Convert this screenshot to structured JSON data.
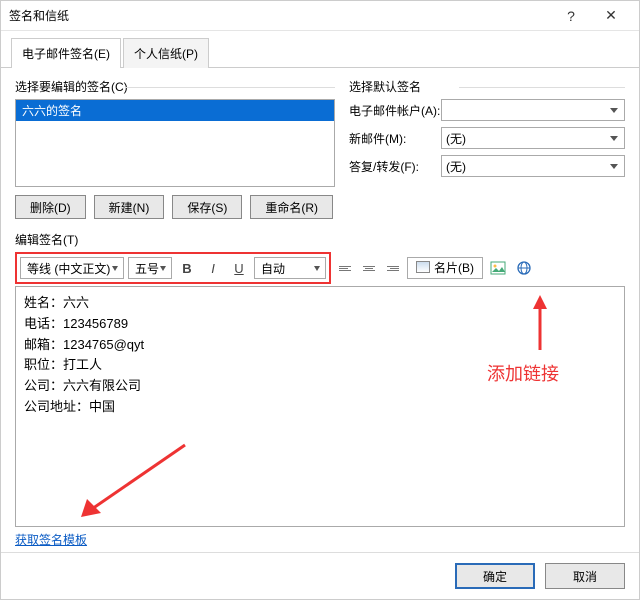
{
  "titlebar": {
    "title": "签名和信纸"
  },
  "tabs": {
    "t1": "电子邮件签名(E)",
    "t2": "个人信纸(P)"
  },
  "left": {
    "label": "选择要编辑的签名(C)",
    "item": "六六的签名",
    "btn_delete": "删除(D)",
    "btn_new": "新建(N)",
    "btn_save": "保存(S)",
    "btn_rename": "重命名(R)"
  },
  "right": {
    "label": "选择默认签名",
    "f1": "电子邮件帐户(A):",
    "v1": "",
    "f2": "新邮件(M):",
    "v2": "(无)",
    "f3": "答复/转发(F):",
    "v3": "(无)"
  },
  "edit": {
    "label": "编辑签名(T)",
    "font": "等线 (中文正文)",
    "size": "五号",
    "color": "自动",
    "card": "名片(B)",
    "body": {
      "l1": "姓名：六六",
      "l2": "电话：123456789",
      "l3": "邮箱：1234765@qyt",
      "l4": "职位：打工人",
      "l5": "公司：六六有限公司",
      "l6": "公司地址：中国"
    }
  },
  "link": "获取签名模板",
  "annotation": "添加链接",
  "footer": {
    "ok": "确定",
    "cancel": "取消"
  }
}
